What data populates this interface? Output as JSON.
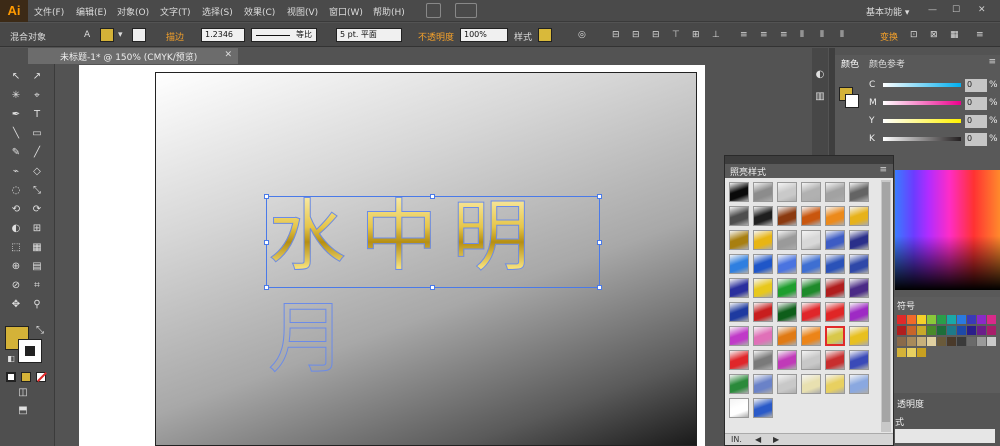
{
  "app": {
    "logo": "Ai"
  },
  "menubar": {
    "items": [
      "文件(F)",
      "编辑(E)",
      "对象(O)",
      "文字(T)",
      "选择(S)",
      "效果(C)",
      "视图(V)",
      "窗口(W)",
      "帮助(H)"
    ],
    "workspace": "基本功能",
    "workspace_arrow": "▾",
    "minimize": "—",
    "restore": "☐",
    "close": "✕"
  },
  "controlbar": {
    "object_type": "混合对象",
    "stroke_label": "描边",
    "stroke_weight": "1.2346",
    "stroke_profile": "等比",
    "brush": "5 pt. 平面",
    "opacity_label": "不透明度",
    "opacity_value": "100%",
    "style_label": "样式",
    "transform_label": "变换"
  },
  "document": {
    "tab_title": "未标题-1* @ 150% (CMYK/预览)",
    "tab_close": "✕",
    "headline": "水中明月"
  },
  "graphic_styles_panel": {
    "title": "照亮样式",
    "menu_icon": "≡",
    "footer_lib": "IN.",
    "footer_prev": "◀",
    "footer_next": "▶",
    "rows": [
      [
        "#0a0a0a",
        "#8c8c8c",
        "#c9c9c9",
        "#b1b1b1",
        "#a2a2a2",
        "#646464"
      ],
      [
        "#4e4e4e",
        "#1f1f1f",
        "#8b3a10",
        "#c9560e",
        "#ec8a1b",
        "#e7b21a"
      ],
      [
        "#a87f10",
        "#e8b514",
        "#9a9a9a",
        "#d8d8d8",
        "#3d5cc4",
        "#2a2f8a"
      ],
      [
        "#2f7fe0",
        "#1f56c8",
        "#4a74e0",
        "#3e6fd2",
        "#2a52b8",
        "#2f48a8"
      ],
      [
        "#2a2f9e",
        "#e8c81c",
        "#1e9e2e",
        "#1e8a2a",
        "#b01e1e",
        "#4a2a86"
      ],
      [
        "#1e3aa0",
        "#c81e1e",
        "#0e5e1a",
        "#e0262a",
        "#e02626",
        "#9e2ac4"
      ],
      [
        "#c03ac8",
        "#e070b8",
        "#e07a14",
        "#ec8418",
        "#d8c84a",
        "#e8c020"
      ],
      [
        "#e0262a",
        "#7a7a7a",
        "#c03ab8",
        "#c8c8c8",
        "#c82e2e",
        "#3a4ab8"
      ],
      [
        "#2a8a3a",
        "#6a82c8",
        "#c8c8c8",
        "#e8e0b0",
        "#e8d060",
        "#8aa8e0"
      ],
      [
        "#ffffff",
        "#2a5ac8"
      ]
    ],
    "selected": [
      6,
      4
    ]
  },
  "color_panel": {
    "tabs": [
      "颜色",
      "颜色参考"
    ],
    "channels": [
      {
        "name": "C",
        "value": "0",
        "unit": "%",
        "color": "#00aeef"
      },
      {
        "name": "M",
        "value": "0",
        "unit": "%",
        "color": "#ec008c"
      },
      {
        "name": "Y",
        "value": "0",
        "unit": "%",
        "color": "#fff200"
      },
      {
        "name": "K",
        "value": "0",
        "unit": "%",
        "color": "#231f20"
      }
    ],
    "fill_color": "#d4b238",
    "stroke_color": "#ffffff"
  },
  "swatches_panel": {
    "title": "符号"
  },
  "transparency_panel": {
    "title": "透明度"
  },
  "style_panel_2": {
    "title": "式"
  },
  "tools": [
    "↖",
    "↗",
    "✳",
    "⌖",
    "✒",
    "T",
    "╲",
    "▭",
    "✎",
    "╱",
    "⌁",
    "◇",
    "◌",
    "⤡",
    "⟲",
    "⟳",
    "◐",
    "⊞",
    "⬚",
    "▦",
    "⊕",
    "▤",
    "⊘",
    "⌗",
    "✥",
    "⚲"
  ]
}
